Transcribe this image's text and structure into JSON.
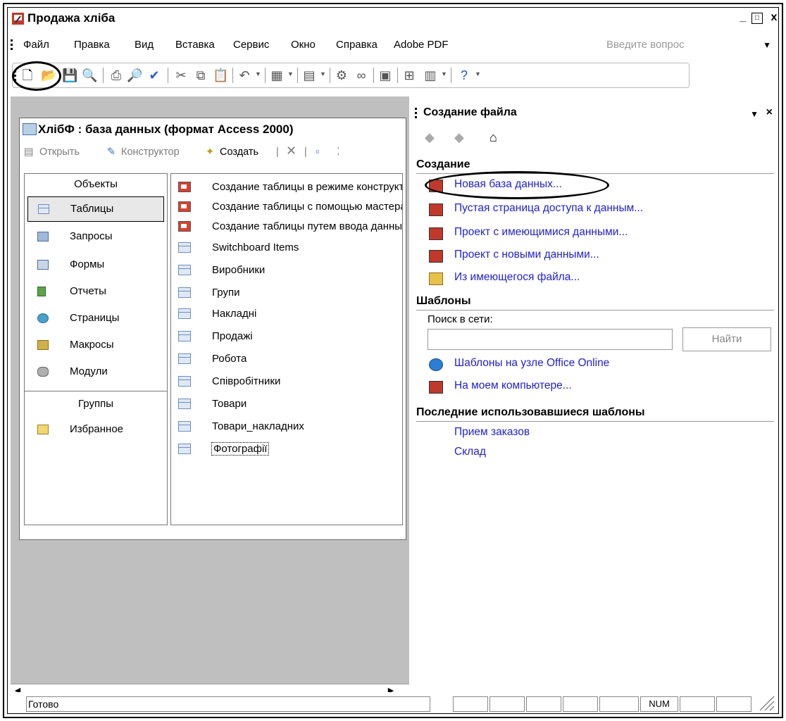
{
  "window": {
    "title": "Продажа хліба"
  },
  "menu": {
    "items": [
      "Файл",
      "Правка",
      "Вид",
      "Вставка",
      "Сервис",
      "Окно",
      "Справка",
      "Adobe PDF"
    ],
    "ask_placeholder": "Введите вопрос"
  },
  "toolbar": {
    "buttons": [
      "new-icon",
      "open-icon",
      "save-icon",
      "file-search-icon",
      "print-icon",
      "print-preview-icon",
      "spelling-icon",
      "cut-icon",
      "copy-icon",
      "paste-icon",
      "undo-icon",
      "office-links-icon",
      "analyze-icon",
      "code-icon",
      "properties-icon",
      "relationships-icon",
      "new-object-icon",
      "help-icon"
    ]
  },
  "db_window": {
    "title": "ХлібФ : база данных (формат Access 2000)",
    "tools": {
      "open": "Открыть",
      "design": "Конструктор",
      "create": "Создать"
    },
    "objects_header": "Объекты",
    "objects": [
      "Таблицы",
      "Запросы",
      "Формы",
      "Отчеты",
      "Страницы",
      "Макросы",
      "Модули"
    ],
    "groups_header": "Группы",
    "groups": [
      "Избранное"
    ],
    "items": [
      "Создание таблицы в режиме конструктора",
      "Создание таблицы с помощью мастера",
      "Создание таблицы путем ввода данных",
      "Switchboard Items",
      "Виробники",
      "Групи",
      "Накладні",
      "Продажі",
      "Робота",
      "Співробітники",
      "Товари",
      "Товари_накладних",
      "Фотографії"
    ]
  },
  "task_pane": {
    "title": "Создание файла",
    "create_section": "Создание",
    "create_links": [
      "Новая база данных...",
      "Пустая страница доступа к данным...",
      "Проект с имеющимися данными...",
      "Проект с новыми данными...",
      "Из имеющегося файла..."
    ],
    "templates_section": "Шаблоны",
    "search_label": "Поиск в сети:",
    "search_button": "Найти",
    "template_links": [
      "Шаблоны на узле Office Online",
      "На моем компьютере..."
    ],
    "recent_section": "Последние использовавшиеся шаблоны",
    "recent_links": [
      "Прием заказов",
      "Склад"
    ]
  },
  "status": {
    "text": "Готово",
    "num": "NUM"
  },
  "colors": {
    "link": "#1f1fcf",
    "workspace": "#bfbfbf"
  }
}
